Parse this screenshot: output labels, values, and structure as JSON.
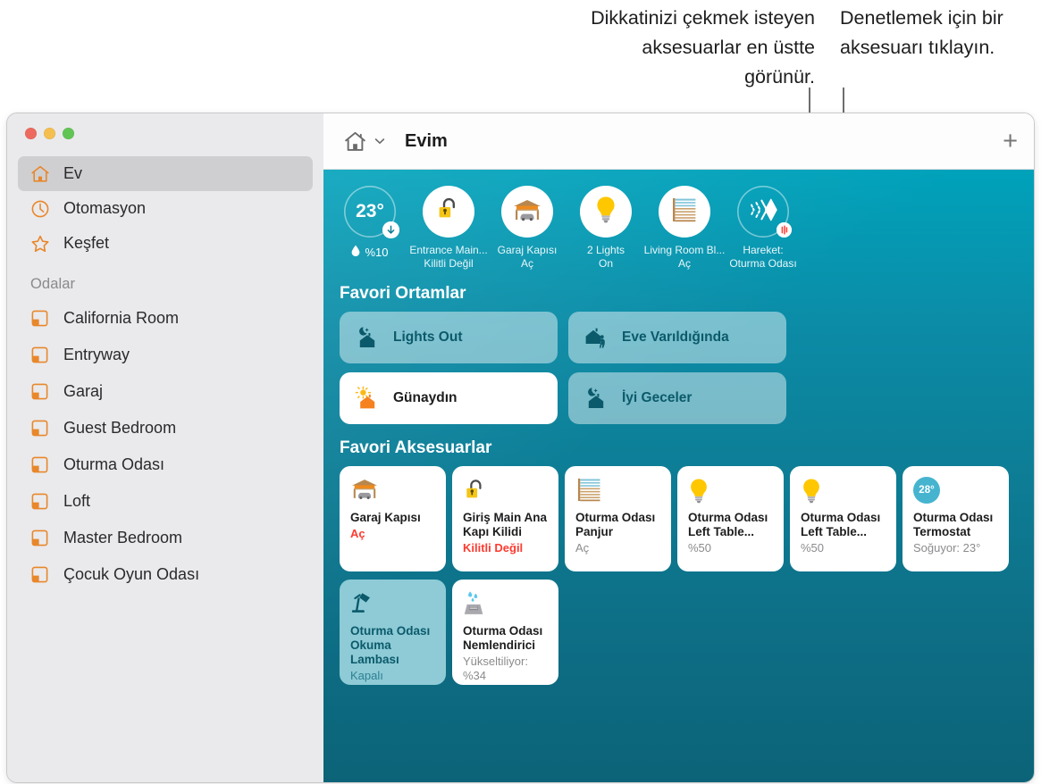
{
  "callouts": {
    "left": "Dikkatinizi çekmek isteyen aksesuarlar en üstte görünür.",
    "right": "Denetlemek için bir aksesuarı tıklayın."
  },
  "window": {
    "toolbar": {
      "title": "Evim",
      "home_icon": "home-icon",
      "chevron_icon": "chevron-down-icon",
      "add_label": "+"
    }
  },
  "sidebar": {
    "nav": [
      {
        "label": "Ev",
        "icon": "home-icon",
        "selected": true
      },
      {
        "label": "Otomasyon",
        "icon": "clock-icon",
        "selected": false
      },
      {
        "label": "Keşfet",
        "icon": "star-icon",
        "selected": false
      }
    ],
    "rooms_header": "Odalar",
    "rooms": [
      {
        "label": "California Room",
        "icon": "room-icon"
      },
      {
        "label": "Entryway",
        "icon": "room-icon"
      },
      {
        "label": "Garaj",
        "icon": "room-icon"
      },
      {
        "label": "Guest Bedroom",
        "icon": "room-icon"
      },
      {
        "label": "Oturma Odası",
        "icon": "room-icon"
      },
      {
        "label": "Loft",
        "icon": "room-icon"
      },
      {
        "label": "Master Bedroom",
        "icon": "room-icon"
      },
      {
        "label": "Çocuk Oyun Odası",
        "icon": "room-icon"
      }
    ]
  },
  "status": [
    {
      "kind": "climate",
      "temp": "23°",
      "humidity": "%10",
      "icon": "droplet-icon",
      "badge": "arrow-down-icon"
    },
    {
      "kind": "accessory",
      "icon": "lock-open-icon",
      "line1": "Entrance Main...",
      "line2": "Kilitli Değil"
    },
    {
      "kind": "accessory",
      "icon": "garage-door-icon",
      "line1": "Garaj Kapısı",
      "line2": "Aç"
    },
    {
      "kind": "accessory",
      "icon": "lightbulb-icon",
      "line1": "2 Lights",
      "line2": "On"
    },
    {
      "kind": "accessory",
      "icon": "blinds-icon",
      "line1": "Living Room Bl...",
      "line2": "Aç"
    },
    {
      "kind": "sensor",
      "icon": "motion-icon",
      "line1": "Hareket:",
      "line2": "Oturma Odası",
      "badge": "sound-wave-icon"
    }
  ],
  "scenes_title": "Favori Ortamlar",
  "scenes": [
    {
      "label": "Lights Out",
      "icon": "moon-house-icon",
      "active": false
    },
    {
      "label": "Eve Varıldığında",
      "icon": "house-person-icon",
      "active": false
    },
    {
      "label": "Günaydın",
      "icon": "sun-house-icon",
      "active": true
    },
    {
      "label": "İyi Geceler",
      "icon": "moon-house-icon",
      "active": false
    }
  ],
  "accessories_title": "Favori Aksesuarlar",
  "accessories": [
    {
      "icon": "garage-door-icon",
      "name": "Garaj Kapısı",
      "state": "Aç",
      "alert": true,
      "on": false
    },
    {
      "icon": "lock-open-icon",
      "name": "Giriş Main Ana Kapı Kilidi",
      "state": "Kilitli Değil",
      "alert": true,
      "on": false
    },
    {
      "icon": "blinds-icon",
      "name": "Oturma Odası Panjur",
      "state": "Aç",
      "alert": false,
      "on": false
    },
    {
      "icon": "lightbulb-icon",
      "name": "Oturma Odası Left Table...",
      "state": "%50",
      "alert": false,
      "on": false
    },
    {
      "icon": "lightbulb-icon",
      "name": "Oturma Odası Left Table...",
      "state": "%50",
      "alert": false,
      "on": false
    },
    {
      "icon": "thermostat-icon",
      "name": "Oturma Odası Termostat",
      "state": "Soğuyor: 23°",
      "badge": "28°",
      "alert": false,
      "on": false
    },
    {
      "icon": "desk-lamp-icon",
      "name": "Oturma Odası Okuma Lambası",
      "state": "Kapalı",
      "alert": false,
      "on": true
    },
    {
      "icon": "humidifier-icon",
      "name": "Oturma Odası Nemlendirici",
      "state": "Yükseltiliyor: %34",
      "alert": false,
      "on": false
    }
  ],
  "colors": {
    "accent_orange": "#e8872b",
    "bg_top": "#00a2bb",
    "bg_bottom": "#0c6378",
    "alert_red": "#ff3b30",
    "lamp_tint": "#8ecbd6",
    "thermostat_badge": "#46b4cf"
  }
}
